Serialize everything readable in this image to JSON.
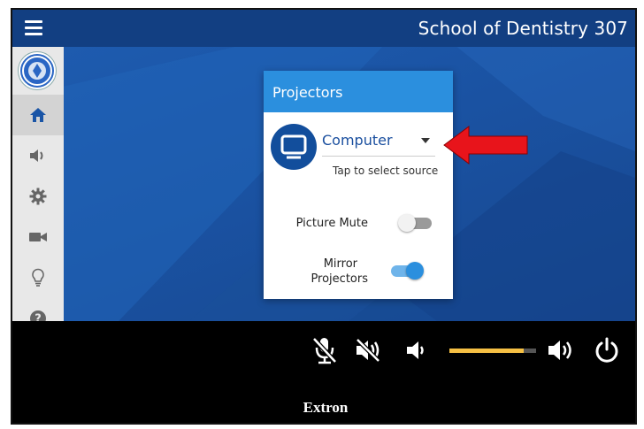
{
  "header": {
    "room_title": "School of Dentistry 307",
    "menu_icon": "hamburger-icon"
  },
  "sidebar": {
    "logo": "university-seal-logo",
    "items": [
      {
        "id": "home",
        "icon": "home-icon",
        "active": true
      },
      {
        "id": "audio",
        "icon": "speaker-icon",
        "active": false
      },
      {
        "id": "settings",
        "icon": "gear-icon",
        "active": false
      },
      {
        "id": "camera",
        "icon": "video-camera-icon",
        "active": false
      },
      {
        "id": "lighting",
        "icon": "lightbulb-icon",
        "active": false
      },
      {
        "id": "help",
        "icon": "help-icon",
        "active": false
      }
    ]
  },
  "projectors_panel": {
    "title": "Projectors",
    "source_icon": "monitor-icon",
    "source_value": "Computer",
    "source_hint": "Tap to select source",
    "picture_mute": {
      "label": "Picture Mute",
      "on": false
    },
    "mirror_projectors": {
      "label_line1": "Mirror",
      "label_line2": "Projectors",
      "on": true
    }
  },
  "annotation": {
    "icon": "red-arrow-icon",
    "color": "#e8141b"
  },
  "controls": {
    "mic_mute_icon": "mic-mute-icon",
    "speaker_mute_icon": "speaker-mute-icon",
    "volume_down_icon": "volume-down-icon",
    "volume_up_icon": "volume-up-icon",
    "power_icon": "power-icon",
    "volume_level": 0.86
  },
  "footer": {
    "brand": "Extron"
  },
  "colors": {
    "accent": "#2b8fde",
    "header_bg": "#123f82",
    "volume_fill": "#f5c044"
  }
}
